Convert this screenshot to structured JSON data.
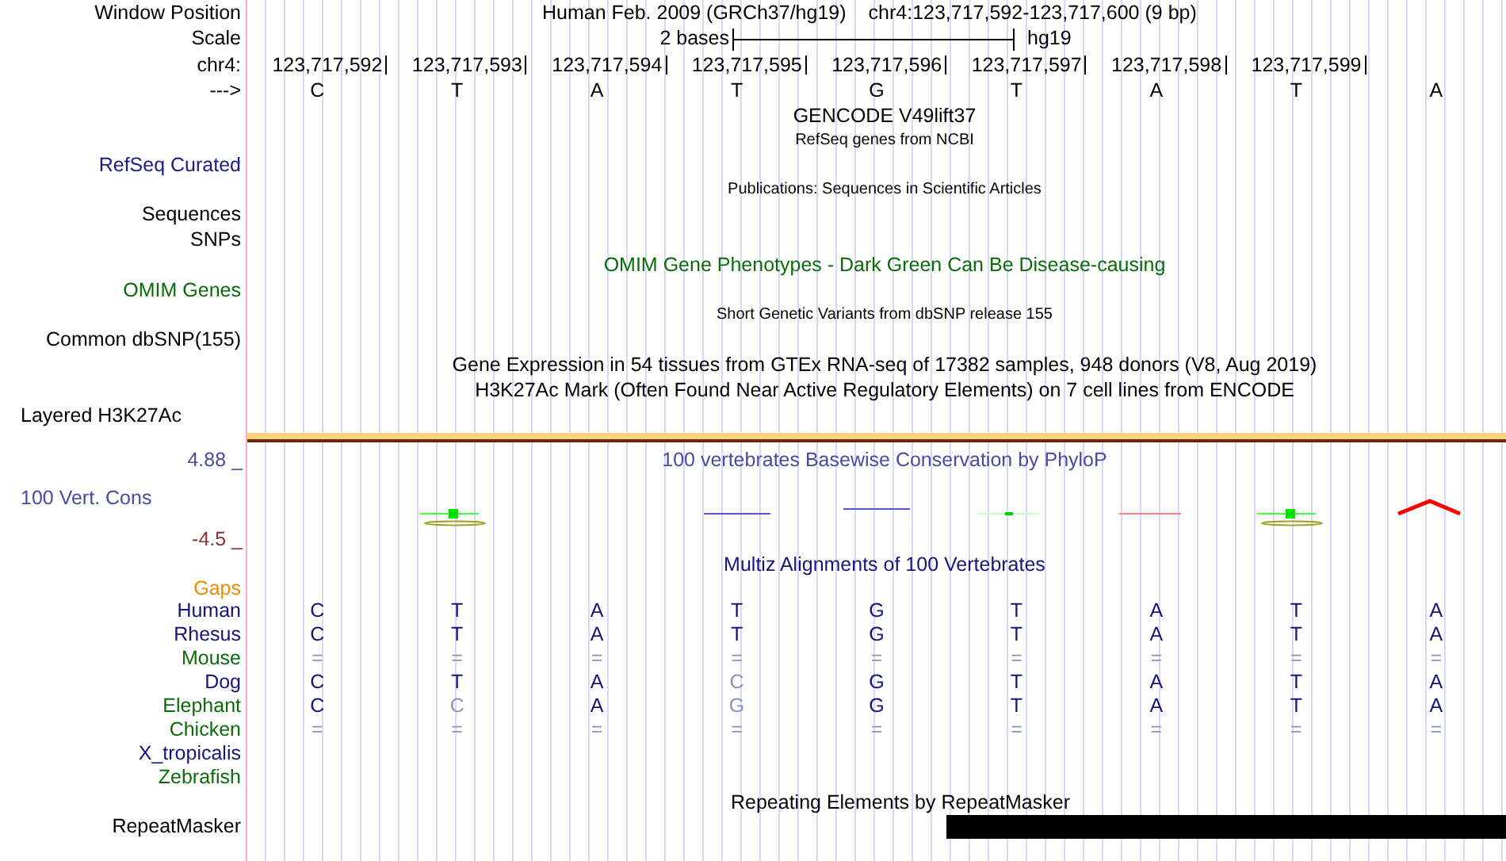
{
  "position": {
    "label": "Window Position",
    "assembly": "Human Feb. 2009 (GRCh37/hg19)",
    "range": "chr4:123,717,592-123,717,600 (9 bp)"
  },
  "scale": {
    "label": "Scale",
    "span": "2 bases",
    "assembly": "hg19"
  },
  "coordinates": {
    "label": "chr4:",
    "ticks": [
      "123,717,592",
      "123,717,593",
      "123,717,594",
      "123,717,595",
      "123,717,596",
      "123,717,597",
      "123,717,598",
      "123,717,599"
    ]
  },
  "sequence": {
    "label": "--->",
    "bases": [
      "C",
      "T",
      "A",
      "T",
      "G",
      "T",
      "A",
      "T",
      "A"
    ]
  },
  "tracks": [
    {
      "kind": "title",
      "text": "GENCODE V49lift37",
      "color": "#000000"
    },
    {
      "kind": "caption",
      "text": "RefSeq genes from NCBI",
      "color": "#000000"
    },
    {
      "kind": "label",
      "text": "RefSeq Curated",
      "color": "#1a1a8c"
    },
    {
      "kind": "caption",
      "text": "Publications: Sequences in Scientific Articles",
      "color": "#000000"
    },
    {
      "kind": "label",
      "text": "Sequences",
      "color": "#000000"
    },
    {
      "kind": "label",
      "text": "SNPs",
      "color": "#000000"
    },
    {
      "kind": "title",
      "text": "OMIM Gene Phenotypes - Dark Green Can Be Disease-causing",
      "color": "#0b6b0b"
    },
    {
      "kind": "label",
      "text": "OMIM Genes",
      "color": "#0b6b0b"
    },
    {
      "kind": "caption",
      "text": "Short Genetic Variants from dbSNP release 155",
      "color": "#000000"
    },
    {
      "kind": "label",
      "text": "Common dbSNP(155)",
      "color": "#000000"
    },
    {
      "kind": "title",
      "text": "Gene Expression in 54 tissues from GTEx RNA-seq of 17382 samples, 948 donors (V8, Aug 2019)",
      "color": "#000000"
    },
    {
      "kind": "title",
      "text": "H3K27Ac Mark (Often Found Near Active Regulatory Elements) on 7 cell lines from ENCODE",
      "color": "#000000"
    },
    {
      "kind": "label_left",
      "text": "Layered H3K27Ac",
      "color": "#000000"
    }
  ],
  "conservation": {
    "title": "100 vertebrates Basewise Conservation by PhyloP",
    "label": "100 Vert. Cons",
    "max": "4.88 _",
    "min": "-4.5 _"
  },
  "multiz": {
    "title": "Multiz Alignments of 100 Vertebrates",
    "gaps_label": "Gaps",
    "species": [
      {
        "name": "Human",
        "color": "#14147a",
        "bases": [
          {
            "b": "C",
            "faded": false
          },
          {
            "b": "T",
            "faded": false
          },
          {
            "b": "A",
            "faded": false
          },
          {
            "b": "T",
            "faded": false
          },
          {
            "b": "G",
            "faded": false
          },
          {
            "b": "T",
            "faded": false
          },
          {
            "b": "A",
            "faded": false
          },
          {
            "b": "T",
            "faded": false
          },
          {
            "b": "A",
            "faded": false
          }
        ]
      },
      {
        "name": "Rhesus",
        "color": "#14147a",
        "bases": [
          {
            "b": "C",
            "faded": false
          },
          {
            "b": "T",
            "faded": false
          },
          {
            "b": "A",
            "faded": false
          },
          {
            "b": "T",
            "faded": false
          },
          {
            "b": "G",
            "faded": false
          },
          {
            "b": "T",
            "faded": false
          },
          {
            "b": "A",
            "faded": false
          },
          {
            "b": "T",
            "faded": false
          },
          {
            "b": "A",
            "faded": false
          }
        ]
      },
      {
        "name": "Mouse",
        "color": "#0b6b0b",
        "bases": [
          {
            "b": "=",
            "faded": true
          },
          {
            "b": "=",
            "faded": true
          },
          {
            "b": "=",
            "faded": true
          },
          {
            "b": "=",
            "faded": true
          },
          {
            "b": "=",
            "faded": true
          },
          {
            "b": "=",
            "faded": true
          },
          {
            "b": "=",
            "faded": true
          },
          {
            "b": "=",
            "faded": true
          },
          {
            "b": "=",
            "faded": true
          }
        ]
      },
      {
        "name": "Dog",
        "color": "#14147a",
        "bases": [
          {
            "b": "C",
            "faded": false
          },
          {
            "b": "T",
            "faded": false
          },
          {
            "b": "A",
            "faded": false
          },
          {
            "b": "C",
            "faded": true
          },
          {
            "b": "G",
            "faded": false
          },
          {
            "b": "T",
            "faded": false
          },
          {
            "b": "A",
            "faded": false
          },
          {
            "b": "T",
            "faded": false
          },
          {
            "b": "A",
            "faded": false
          }
        ]
      },
      {
        "name": "Elephant",
        "color": "#0b6b0b",
        "bases": [
          {
            "b": "C",
            "faded": false
          },
          {
            "b": "C",
            "faded": true
          },
          {
            "b": "A",
            "faded": false
          },
          {
            "b": "G",
            "faded": true
          },
          {
            "b": "G",
            "faded": false
          },
          {
            "b": "T",
            "faded": false
          },
          {
            "b": "A",
            "faded": false
          },
          {
            "b": "T",
            "faded": false
          },
          {
            "b": "A",
            "faded": false
          }
        ]
      },
      {
        "name": "Chicken",
        "color": "#0b6b0b",
        "bases": [
          {
            "b": "=",
            "faded": true
          },
          {
            "b": "=",
            "faded": true
          },
          {
            "b": "=",
            "faded": true
          },
          {
            "b": "=",
            "faded": true
          },
          {
            "b": "=",
            "faded": true
          },
          {
            "b": "=",
            "faded": true
          },
          {
            "b": "=",
            "faded": true
          },
          {
            "b": "=",
            "faded": true
          },
          {
            "b": "=",
            "faded": true
          }
        ]
      },
      {
        "name": "X_tropicalis",
        "color": "#14147a"
      },
      {
        "name": "Zebrafish",
        "color": "#0b6b0b"
      }
    ]
  },
  "repeats": {
    "title": "Repeating Elements by RepeatMasker",
    "label": "RepeatMasker"
  }
}
